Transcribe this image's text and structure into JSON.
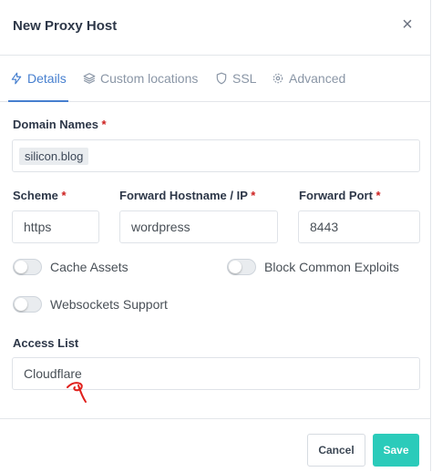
{
  "modal": {
    "title": "New Proxy Host",
    "close_glyph": "×"
  },
  "tabs": [
    {
      "label": "Details",
      "icon": "bolt-icon",
      "active": true
    },
    {
      "label": "Custom locations",
      "icon": "layers-icon",
      "active": false
    },
    {
      "label": "SSL",
      "icon": "shield-icon",
      "active": false
    },
    {
      "label": "Advanced",
      "icon": "gear-icon",
      "active": false
    }
  ],
  "form": {
    "domain_names": {
      "label": "Domain Names",
      "required_mark": "*",
      "chips": [
        "silicon.blog"
      ]
    },
    "scheme": {
      "label": "Scheme",
      "required_mark": "*",
      "value": "https"
    },
    "forward_hostname": {
      "label": "Forward Hostname / IP",
      "required_mark": "*",
      "value": "wordpress"
    },
    "forward_port": {
      "label": "Forward Port",
      "required_mark": "*",
      "value": "8443"
    },
    "toggles": [
      {
        "label": "Cache Assets",
        "on": false
      },
      {
        "label": "Block Common Exploits",
        "on": false
      },
      {
        "label": "Websockets Support",
        "on": false
      }
    ],
    "access_list": {
      "label": "Access List",
      "value": "Cloudflare"
    }
  },
  "footer": {
    "cancel_label": "Cancel",
    "save_label": "Save"
  },
  "colors": {
    "accent": "#467fcf",
    "save": "#2bcbba",
    "required": "#cd201f",
    "annotation": "#e0201c"
  }
}
